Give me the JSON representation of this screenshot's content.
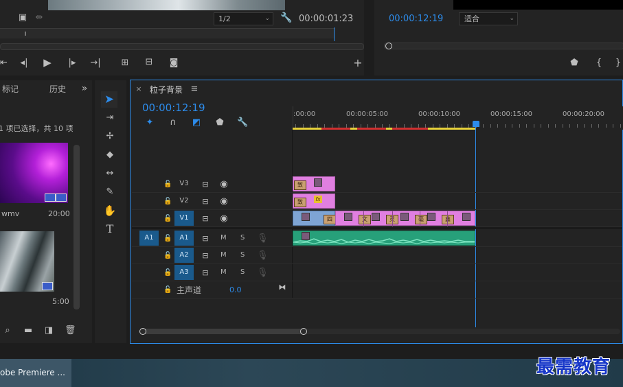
{
  "source_monitor": {
    "resolution": "1/2",
    "timecode": "00:00:01:23"
  },
  "program_monitor": {
    "timecode": "00:00:12:19",
    "fit": "适合"
  },
  "project_panel": {
    "tabs": [
      "标记",
      "历史"
    ],
    "selection_info": "1 项已选择，共 10 项",
    "items": [
      {
        "name": "wmv",
        "duration": "20:00"
      },
      {
        "name": "",
        "duration": "5:00"
      }
    ]
  },
  "timeline": {
    "sequence_name": "粒子背景",
    "timecode": "00:00:12:19",
    "ruler": [
      ":00:00",
      "00:00:05:00",
      "00:00:10:00",
      "00:00:15:00",
      "00:00:20:00"
    ],
    "video_tracks": [
      "V3",
      "V2",
      "V1"
    ],
    "audio_tracks": [
      "A1",
      "A2",
      "A3"
    ],
    "source_patch": "A1",
    "master_label": "主声道",
    "master_value": "0.0",
    "mute_label": "M",
    "solo_label": "S",
    "clip_thumbs": {
      "v3": "致",
      "v2": "致",
      "v1": [
        "四",
        "文",
        "灵",
        "毫",
        "鑫"
      ]
    },
    "fx_label": "fx"
  },
  "taskbar": {
    "app_title": "obe Premiere ..."
  },
  "watermark": "最需教育",
  "colors": {
    "accent": "#2d8ceb",
    "clip_pink": "#e07fe0",
    "clip_blue": "#7ea4d4",
    "audio_green": "#27a07a",
    "track_on": "#1a5a8c",
    "watermark": "#1535c8"
  }
}
